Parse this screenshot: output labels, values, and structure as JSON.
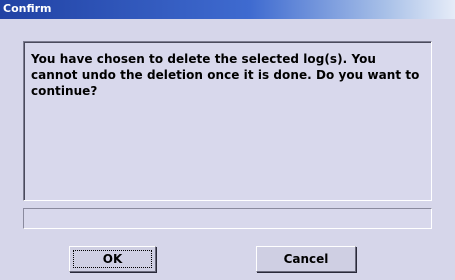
{
  "window": {
    "title": "Confirm"
  },
  "dialog": {
    "message": "You have chosen to delete the selected log(s). You cannot undo the deletion once it is done. Do you want to continue?",
    "status_text": ""
  },
  "buttons": {
    "ok_label": "OK",
    "cancel_label": "Cancel"
  },
  "colors": {
    "titlebar_start": "#2142a4",
    "titlebar_end": "#e6ecf8",
    "dialog_background": "#d6d6ea"
  }
}
